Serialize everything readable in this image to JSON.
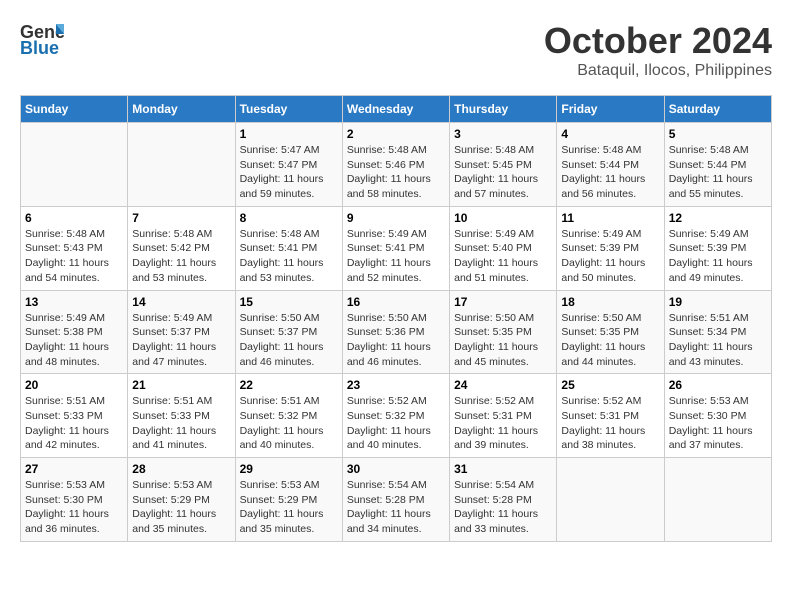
{
  "header": {
    "logo_general": "General",
    "logo_blue": "Blue",
    "month": "October 2024",
    "location": "Bataquil, Ilocos, Philippines"
  },
  "weekdays": [
    "Sunday",
    "Monday",
    "Tuesday",
    "Wednesday",
    "Thursday",
    "Friday",
    "Saturday"
  ],
  "weeks": [
    [
      {
        "day": "",
        "info": ""
      },
      {
        "day": "",
        "info": ""
      },
      {
        "day": "1",
        "info": "Sunrise: 5:47 AM\nSunset: 5:47 PM\nDaylight: 11 hours and 59 minutes."
      },
      {
        "day": "2",
        "info": "Sunrise: 5:48 AM\nSunset: 5:46 PM\nDaylight: 11 hours and 58 minutes."
      },
      {
        "day": "3",
        "info": "Sunrise: 5:48 AM\nSunset: 5:45 PM\nDaylight: 11 hours and 57 minutes."
      },
      {
        "day": "4",
        "info": "Sunrise: 5:48 AM\nSunset: 5:44 PM\nDaylight: 11 hours and 56 minutes."
      },
      {
        "day": "5",
        "info": "Sunrise: 5:48 AM\nSunset: 5:44 PM\nDaylight: 11 hours and 55 minutes."
      }
    ],
    [
      {
        "day": "6",
        "info": "Sunrise: 5:48 AM\nSunset: 5:43 PM\nDaylight: 11 hours and 54 minutes."
      },
      {
        "day": "7",
        "info": "Sunrise: 5:48 AM\nSunset: 5:42 PM\nDaylight: 11 hours and 53 minutes."
      },
      {
        "day": "8",
        "info": "Sunrise: 5:48 AM\nSunset: 5:41 PM\nDaylight: 11 hours and 53 minutes."
      },
      {
        "day": "9",
        "info": "Sunrise: 5:49 AM\nSunset: 5:41 PM\nDaylight: 11 hours and 52 minutes."
      },
      {
        "day": "10",
        "info": "Sunrise: 5:49 AM\nSunset: 5:40 PM\nDaylight: 11 hours and 51 minutes."
      },
      {
        "day": "11",
        "info": "Sunrise: 5:49 AM\nSunset: 5:39 PM\nDaylight: 11 hours and 50 minutes."
      },
      {
        "day": "12",
        "info": "Sunrise: 5:49 AM\nSunset: 5:39 PM\nDaylight: 11 hours and 49 minutes."
      }
    ],
    [
      {
        "day": "13",
        "info": "Sunrise: 5:49 AM\nSunset: 5:38 PM\nDaylight: 11 hours and 48 minutes."
      },
      {
        "day": "14",
        "info": "Sunrise: 5:49 AM\nSunset: 5:37 PM\nDaylight: 11 hours and 47 minutes."
      },
      {
        "day": "15",
        "info": "Sunrise: 5:50 AM\nSunset: 5:37 PM\nDaylight: 11 hours and 46 minutes."
      },
      {
        "day": "16",
        "info": "Sunrise: 5:50 AM\nSunset: 5:36 PM\nDaylight: 11 hours and 46 minutes."
      },
      {
        "day": "17",
        "info": "Sunrise: 5:50 AM\nSunset: 5:35 PM\nDaylight: 11 hours and 45 minutes."
      },
      {
        "day": "18",
        "info": "Sunrise: 5:50 AM\nSunset: 5:35 PM\nDaylight: 11 hours and 44 minutes."
      },
      {
        "day": "19",
        "info": "Sunrise: 5:51 AM\nSunset: 5:34 PM\nDaylight: 11 hours and 43 minutes."
      }
    ],
    [
      {
        "day": "20",
        "info": "Sunrise: 5:51 AM\nSunset: 5:33 PM\nDaylight: 11 hours and 42 minutes."
      },
      {
        "day": "21",
        "info": "Sunrise: 5:51 AM\nSunset: 5:33 PM\nDaylight: 11 hours and 41 minutes."
      },
      {
        "day": "22",
        "info": "Sunrise: 5:51 AM\nSunset: 5:32 PM\nDaylight: 11 hours and 40 minutes."
      },
      {
        "day": "23",
        "info": "Sunrise: 5:52 AM\nSunset: 5:32 PM\nDaylight: 11 hours and 40 minutes."
      },
      {
        "day": "24",
        "info": "Sunrise: 5:52 AM\nSunset: 5:31 PM\nDaylight: 11 hours and 39 minutes."
      },
      {
        "day": "25",
        "info": "Sunrise: 5:52 AM\nSunset: 5:31 PM\nDaylight: 11 hours and 38 minutes."
      },
      {
        "day": "26",
        "info": "Sunrise: 5:53 AM\nSunset: 5:30 PM\nDaylight: 11 hours and 37 minutes."
      }
    ],
    [
      {
        "day": "27",
        "info": "Sunrise: 5:53 AM\nSunset: 5:30 PM\nDaylight: 11 hours and 36 minutes."
      },
      {
        "day": "28",
        "info": "Sunrise: 5:53 AM\nSunset: 5:29 PM\nDaylight: 11 hours and 35 minutes."
      },
      {
        "day": "29",
        "info": "Sunrise: 5:53 AM\nSunset: 5:29 PM\nDaylight: 11 hours and 35 minutes."
      },
      {
        "day": "30",
        "info": "Sunrise: 5:54 AM\nSunset: 5:28 PM\nDaylight: 11 hours and 34 minutes."
      },
      {
        "day": "31",
        "info": "Sunrise: 5:54 AM\nSunset: 5:28 PM\nDaylight: 11 hours and 33 minutes."
      },
      {
        "day": "",
        "info": ""
      },
      {
        "day": "",
        "info": ""
      }
    ]
  ]
}
